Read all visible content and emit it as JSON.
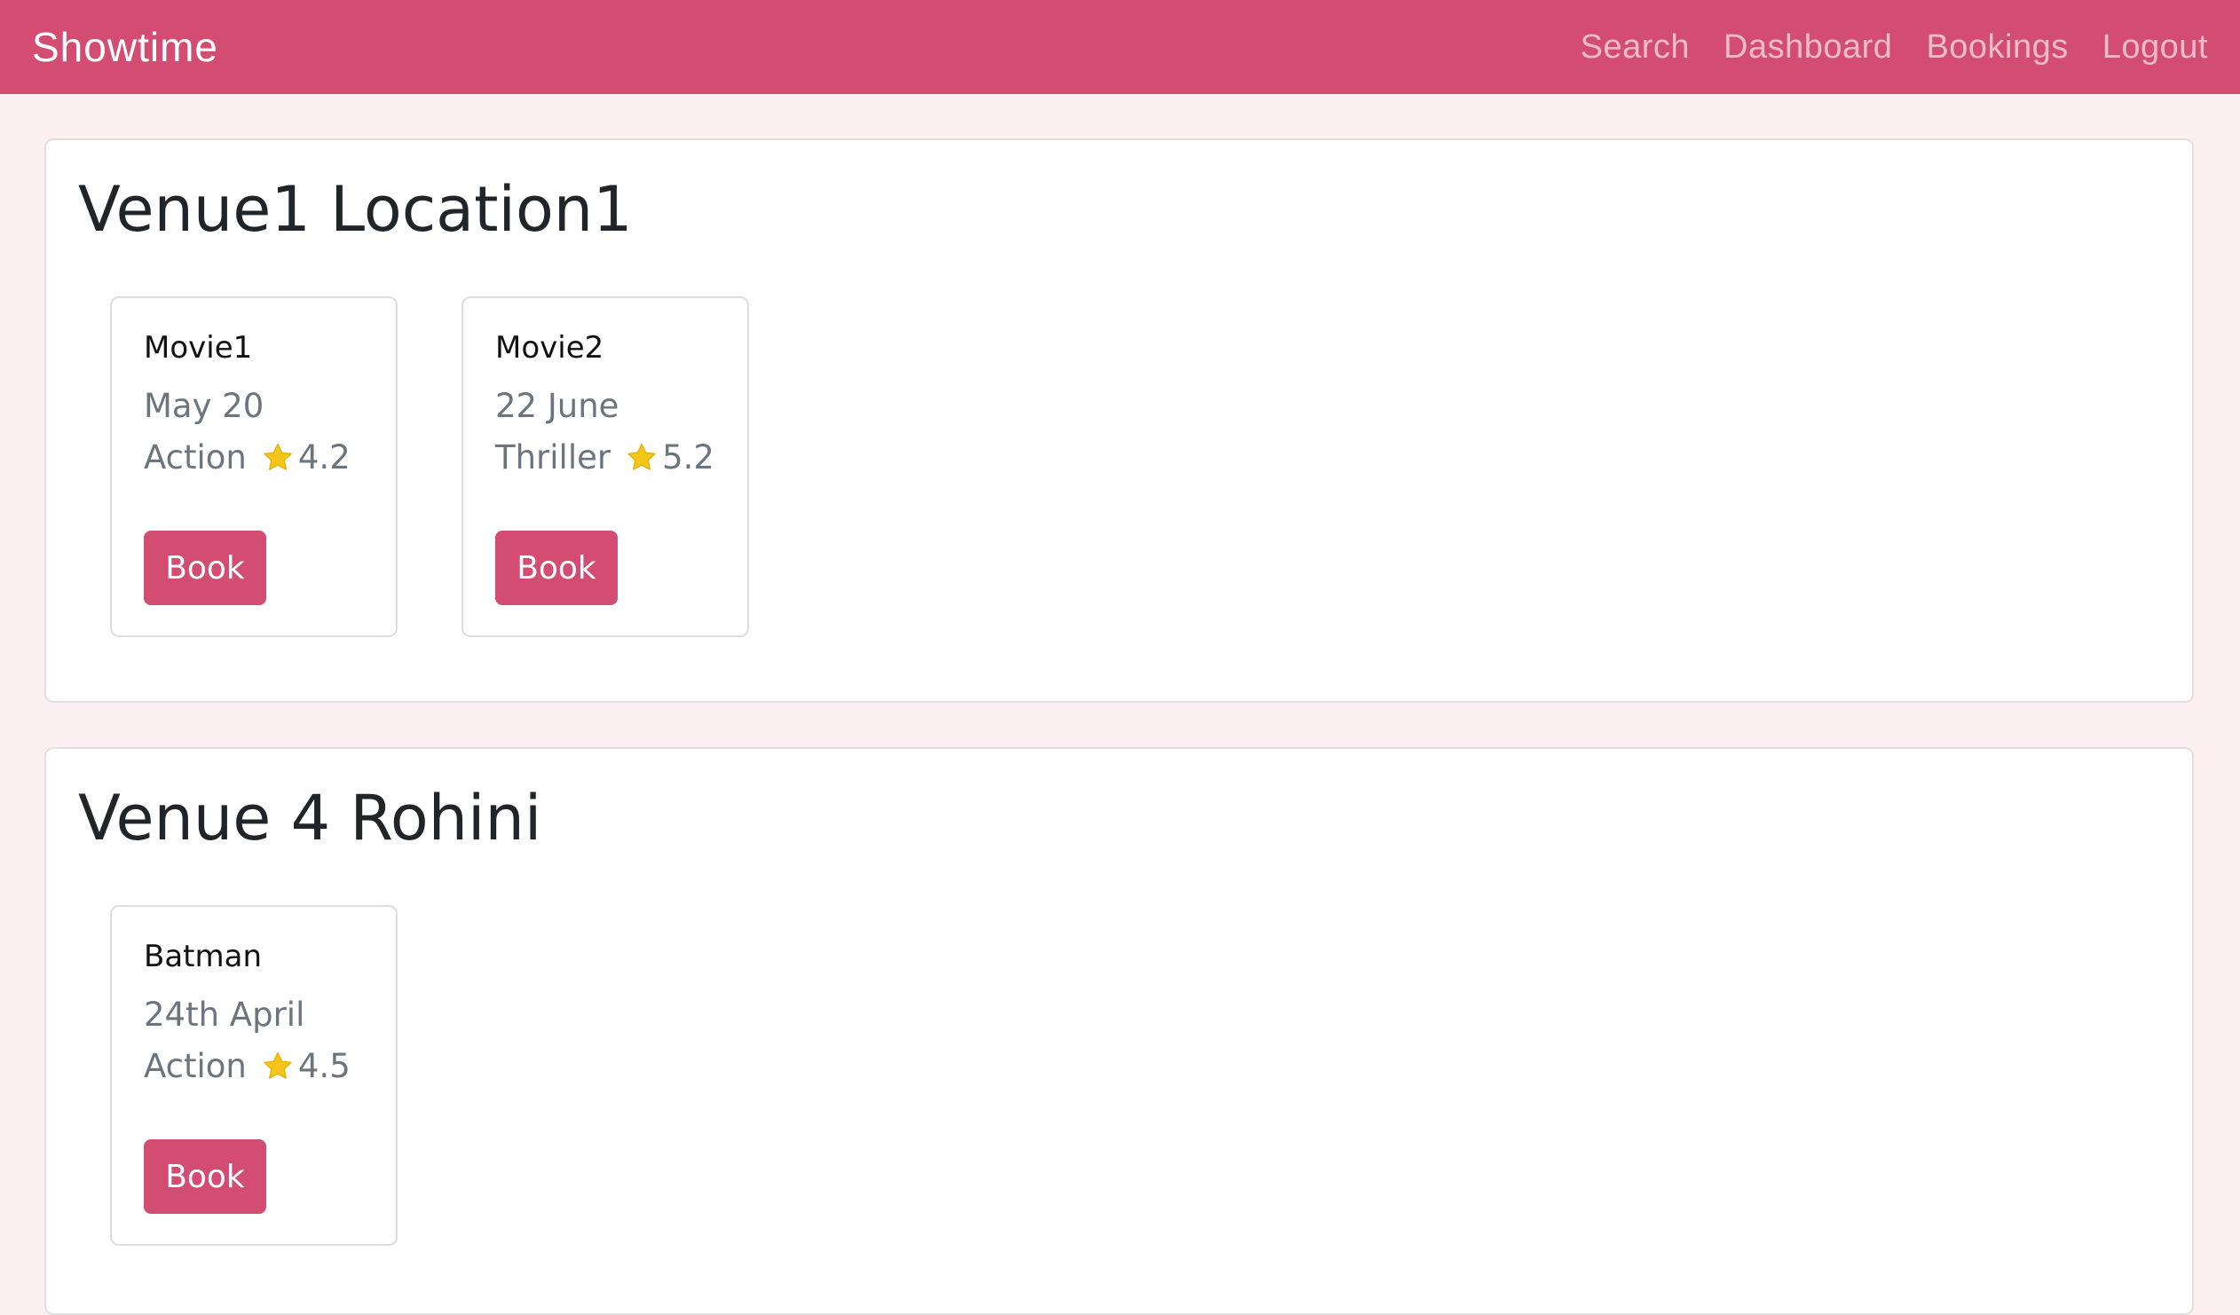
{
  "navbar": {
    "brand": "Showtime",
    "links": [
      "Search",
      "Dashboard",
      "Bookings",
      "Logout"
    ],
    "color": "#d34d72"
  },
  "venues": [
    {
      "title": "Venue1 Location1",
      "shows": [
        {
          "name": "Movie1",
          "date": "May 20",
          "genre": "Action",
          "rating": "4.2",
          "button": "Book"
        },
        {
          "name": "Movie2",
          "date": "22 June",
          "genre": "Thriller",
          "rating": "5.2",
          "button": "Book"
        }
      ]
    },
    {
      "title": "Venue 4 Rohini",
      "shows": [
        {
          "name": "Batman",
          "date": "24th April",
          "genre": "Action",
          "rating": "4.5",
          "button": "Book"
        }
      ]
    }
  ],
  "icons": {
    "rating": "star-icon"
  },
  "colors": {
    "accent": "#d34d72",
    "star": "#f5c518",
    "background": "#fdf0f3"
  }
}
